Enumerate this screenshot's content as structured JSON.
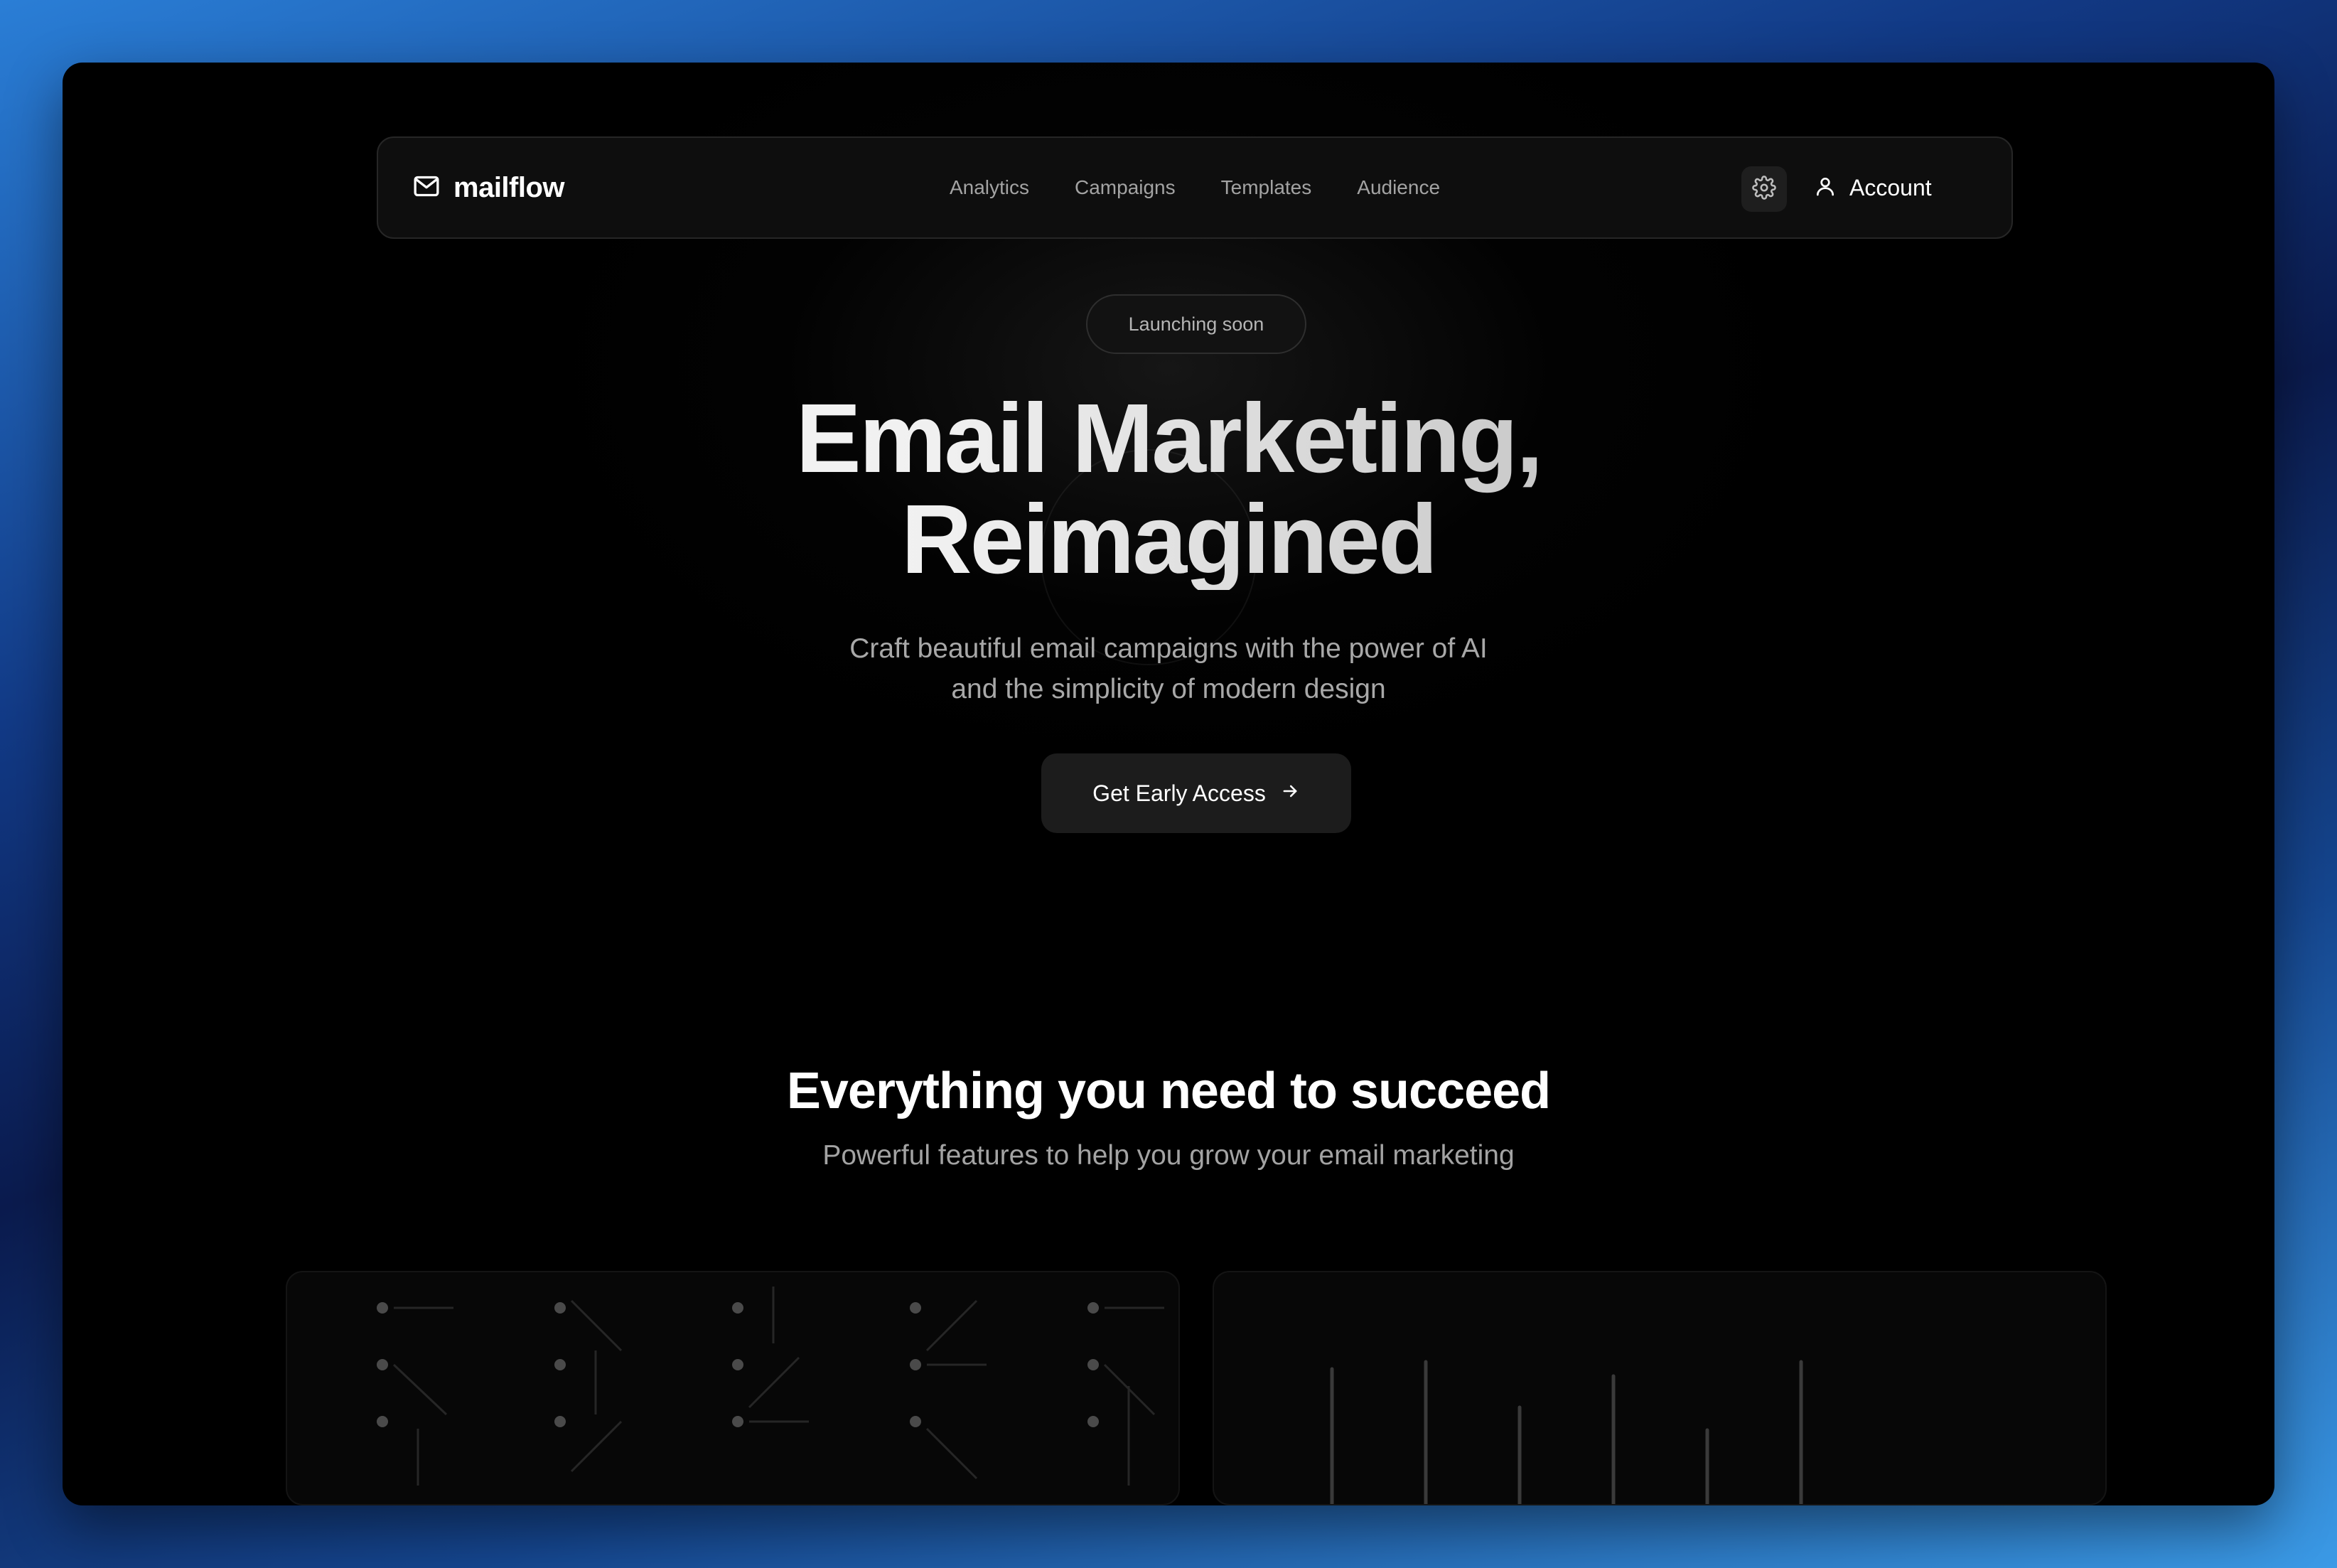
{
  "brand": {
    "name": "mailflow",
    "icon": "mail-icon"
  },
  "nav": {
    "links": [
      "Analytics",
      "Campaigns",
      "Templates",
      "Audience"
    ],
    "settings_icon": "gear-icon",
    "account_label": "Account",
    "account_icon": "user-icon"
  },
  "hero": {
    "badge": "Launching soon",
    "title_line1": "Email Marketing,",
    "title_line2": "Reimagined",
    "subtitle_line1": "Craft beautiful email campaigns with the power of AI",
    "subtitle_line2": "and the simplicity of modern design",
    "cta_label": "Get Early Access",
    "cta_icon": "arrow-right-icon"
  },
  "features": {
    "title": "Everything you need to succeed",
    "subtitle": "Powerful features to help you grow your email marketing"
  },
  "colors": {
    "page_background": "#000000",
    "nav_background": "#0e0e0e",
    "cta_background": "#1c1c1c",
    "muted_text": "#a3a3a3"
  }
}
